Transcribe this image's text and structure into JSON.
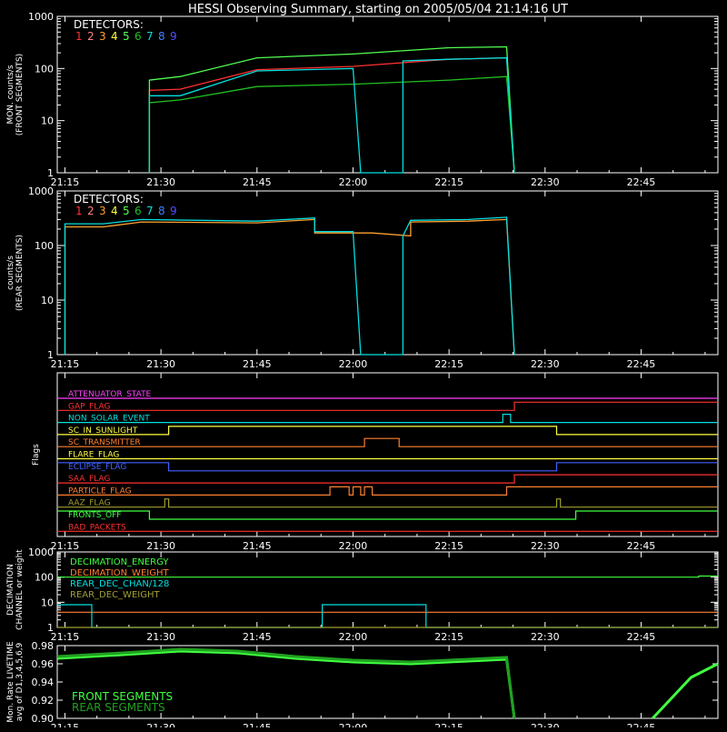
{
  "title": "HESSI Observing Summary, starting on 2005/05/04 21:14:16 UT",
  "time_ticks": [
    "21:15",
    "21:30",
    "21:45",
    "22:00",
    "22:15",
    "22:30",
    "22:45"
  ],
  "detector_colors": [
    "#ff3030",
    "#ff8080",
    "#ffa030",
    "#ffff40",
    "#50ff50",
    "#20c020",
    "#00e0e0",
    "#4080ff",
    "#5050ff"
  ],
  "chart_data": [
    {
      "type": "line",
      "panel": "front",
      "ylabel": "MON. counts/s (FRONT SEGMENTS)",
      "ylabel_lines": [
        "MON. counts/s",
        "(FRONT SEGMENTS)"
      ],
      "yscale": "log",
      "ylim": [
        1,
        1000
      ],
      "ytick_labels": [
        "1",
        "10",
        "100",
        "1000"
      ],
      "legend_title": "DETECTORS:",
      "legend_labels": [
        "1",
        "2",
        "3",
        "4",
        "5",
        "6",
        "7",
        "8",
        "9"
      ],
      "series": [
        {
          "name": "1",
          "color": "#ff3030",
          "values": [
            [
              21.47,
              1
            ],
            [
              21.47,
              38
            ],
            [
              21.55,
              40
            ],
            [
              21.75,
              95
            ],
            [
              22.0,
              110
            ],
            [
              22.25,
              150
            ],
            [
              22.4,
              160
            ],
            [
              22.42,
              1
            ]
          ]
        },
        {
          "name": "5",
          "color": "#50ff50",
          "values": [
            [
              21.47,
              1
            ],
            [
              21.47,
              60
            ],
            [
              21.55,
              70
            ],
            [
              21.75,
              160
            ],
            [
              22.0,
              190
            ],
            [
              22.25,
              250
            ],
            [
              22.4,
              260
            ],
            [
              22.42,
              1
            ]
          ]
        },
        {
          "name": "6",
          "color": "#20c020",
          "values": [
            [
              21.47,
              1
            ],
            [
              21.47,
              22
            ],
            [
              21.55,
              25
            ],
            [
              21.75,
              45
            ],
            [
              22.0,
              50
            ],
            [
              22.25,
              60
            ],
            [
              22.4,
              70
            ],
            [
              22.42,
              1
            ]
          ]
        },
        {
          "name": "7",
          "color": "#00e0e0",
          "values": [
            [
              21.47,
              1
            ],
            [
              21.47,
              30
            ],
            [
              21.55,
              30
            ],
            [
              21.75,
              90
            ],
            [
              22.0,
              100
            ],
            [
              22.02,
              1
            ],
            [
              22.13,
              1
            ],
            [
              22.13,
              140
            ],
            [
              22.25,
              150
            ],
            [
              22.4,
              160
            ],
            [
              22.42,
              1
            ]
          ]
        }
      ]
    },
    {
      "type": "line",
      "panel": "rear",
      "ylabel": "counts/s (REAR SEGMENTS)",
      "ylabel_lines": [
        "counts/s",
        "(REAR SEGMENTS)"
      ],
      "yscale": "log",
      "ylim": [
        1,
        1000
      ],
      "ytick_labels": [
        "1",
        "10",
        "100",
        "1000"
      ],
      "legend_title": "DETECTORS:",
      "legend_labels": [
        "1",
        "2",
        "3",
        "4",
        "5",
        "6",
        "7",
        "8",
        "9"
      ],
      "series": [
        {
          "name": "3",
          "color": "#ffa030",
          "values": [
            [
              21.25,
              1
            ],
            [
              21.25,
              220
            ],
            [
              21.35,
              220
            ],
            [
              21.45,
              270
            ],
            [
              21.75,
              260
            ],
            [
              21.9,
              300
            ],
            [
              21.9,
              170
            ],
            [
              22.05,
              170
            ],
            [
              22.15,
              150
            ],
            [
              22.15,
              270
            ],
            [
              22.3,
              280
            ],
            [
              22.4,
              300
            ],
            [
              22.42,
              1
            ]
          ]
        },
        {
          "name": "7",
          "color": "#00e0e0",
          "values": [
            [
              21.25,
              1
            ],
            [
              21.25,
              250
            ],
            [
              21.35,
              250
            ],
            [
              21.45,
              300
            ],
            [
              21.75,
              280
            ],
            [
              21.9,
              320
            ],
            [
              21.9,
              180
            ],
            [
              22.0,
              180
            ],
            [
              22.02,
              1
            ],
            [
              22.13,
              1
            ],
            [
              22.13,
              150
            ],
            [
              22.15,
              290
            ],
            [
              22.3,
              300
            ],
            [
              22.4,
              330
            ],
            [
              22.42,
              1
            ]
          ]
        }
      ]
    },
    {
      "type": "line",
      "panel": "flags",
      "ylabel": "Flags",
      "flags": [
        {
          "name": "ATTENUATOR_STATE",
          "color": "#ff40ff",
          "segments": [
            [
              21.23,
              22.95,
              0
            ]
          ]
        },
        {
          "name": "GAP_FLAG",
          "color": "#ff3030",
          "segments": [
            [
              21.23,
              22.42,
              0
            ],
            [
              22.42,
              22.95,
              1
            ]
          ]
        },
        {
          "name": "NON_SOLAR_EVENT",
          "color": "#00e0e0",
          "segments": [
            [
              21.23,
              22.39,
              0
            ],
            [
              22.39,
              22.41,
              1
            ],
            [
              22.41,
              22.95,
              0
            ]
          ]
        },
        {
          "name": "SC_IN_SUNLIGHT",
          "color": "#ffff40",
          "segments": [
            [
              21.23,
              21.52,
              0
            ],
            [
              21.52,
              22.53,
              1
            ],
            [
              22.53,
              22.95,
              0
            ]
          ]
        },
        {
          "name": "SC_TRANSMITTER",
          "color": "#ff8030",
          "segments": [
            [
              21.23,
              22.03,
              0
            ],
            [
              22.03,
              22.12,
              1
            ],
            [
              22.12,
              22.95,
              0
            ]
          ]
        },
        {
          "name": "FLARE_FLAG",
          "color": "#ffff40",
          "segments": [
            [
              21.23,
              22.95,
              0
            ]
          ]
        },
        {
          "name": "ECLIPSE_FLAG",
          "color": "#4060ff",
          "segments": [
            [
              21.23,
              21.52,
              1
            ],
            [
              21.52,
              22.53,
              0
            ],
            [
              22.53,
              22.95,
              1
            ]
          ]
        },
        {
          "name": "SAA_FLAG",
          "color": "#ff3030",
          "segments": [
            [
              21.23,
              22.42,
              0
            ],
            [
              22.42,
              22.95,
              1
            ]
          ]
        },
        {
          "name": "PARTICLE_FLAG",
          "color": "#ff8030",
          "segments": [
            [
              21.23,
              21.94,
              0
            ],
            [
              21.94,
              21.99,
              1
            ],
            [
              21.99,
              22.0,
              0
            ],
            [
              22.0,
              22.02,
              1
            ],
            [
              22.02,
              22.03,
              0
            ],
            [
              22.03,
              22.05,
              1
            ],
            [
              22.05,
              22.4,
              0
            ],
            [
              22.4,
              22.95,
              1
            ]
          ]
        },
        {
          "name": "AAZ_FLAG",
          "color": "#a0a030",
          "segments": [
            [
              21.23,
              21.51,
              0
            ],
            [
              21.51,
              21.52,
              1
            ],
            [
              21.52,
              22.53,
              0
            ],
            [
              22.53,
              22.54,
              1
            ],
            [
              22.54,
              22.95,
              0
            ]
          ]
        },
        {
          "name": "FRONTS_OFF",
          "color": "#40ff40",
          "segments": [
            [
              21.23,
              21.47,
              1
            ],
            [
              21.47,
              22.58,
              0
            ],
            [
              22.58,
              22.95,
              1
            ]
          ]
        },
        {
          "name": "BAD_PACKETS",
          "color": "#ff3030",
          "segments": [
            [
              21.23,
              22.95,
              0
            ]
          ]
        }
      ]
    },
    {
      "type": "line",
      "panel": "decimation",
      "ylabel": "DECIMATION CHANNEL or weight",
      "ylabel_lines": [
        "DECIMATION",
        "CHANNEL or weight"
      ],
      "yscale": "log",
      "ylim": [
        1,
        1000
      ],
      "ytick_labels": [
        "1",
        "10",
        "100",
        "1000"
      ],
      "series": [
        {
          "name": "DECIMATION_ENERGY",
          "color": "#40ff40",
          "values": [
            [
              21.23,
              100
            ],
            [
              22.9,
              100
            ],
            [
              22.9,
              110
            ],
            [
              22.95,
              110
            ]
          ]
        },
        {
          "name": "DECIMATION_WEIGHT",
          "color": "#ff8030",
          "values": [
            [
              21.23,
              4
            ],
            [
              22.95,
              4
            ]
          ]
        },
        {
          "name": "REAR_DEC_CHAN/128",
          "color": "#00e0e0",
          "values": [
            [
              21.23,
              8
            ],
            [
              21.32,
              8
            ],
            [
              21.32,
              1
            ],
            [
              21.92,
              1
            ],
            [
              21.92,
              8
            ],
            [
              22.19,
              8
            ],
            [
              22.19,
              1
            ],
            [
              22.95,
              1
            ]
          ]
        },
        {
          "name": "REAR_DEC_WEIGHT",
          "color": "#a0a030",
          "values": [
            [
              21.23,
              1
            ],
            [
              22.95,
              1
            ]
          ]
        }
      ]
    },
    {
      "type": "line",
      "panel": "livetime",
      "ylabel": "Mon. Rate LIVETIME avg of D1,3,4,5,6,9",
      "ylabel_lines": [
        "Mon. Rate LIVETIME",
        "avg of D1,3,4,5,6,9"
      ],
      "ylim": [
        0.9,
        0.98
      ],
      "ytick_labels": [
        "0.90",
        "0.92",
        "0.94",
        "0.96",
        "0.98"
      ],
      "series": [
        {
          "name": "FRONT SEGMENTS",
          "color": "#40ff40",
          "values": [
            [
              21.23,
              0.966
            ],
            [
              21.4,
              0.97
            ],
            [
              21.55,
              0.974
            ],
            [
              21.7,
              0.972
            ],
            [
              21.85,
              0.966
            ],
            [
              22.0,
              0.962
            ],
            [
              22.15,
              0.96
            ],
            [
              22.3,
              0.963
            ],
            [
              22.4,
              0.965
            ],
            [
              22.42,
              0.9
            ]
          ]
        },
        {
          "name": "REAR SEGMENTS",
          "color": "#20a020",
          "values": [
            [
              21.23,
              0.968
            ],
            [
              21.4,
              0.972
            ],
            [
              21.55,
              0.976
            ],
            [
              21.7,
              0.974
            ],
            [
              21.85,
              0.968
            ],
            [
              22.0,
              0.964
            ],
            [
              22.15,
              0.962
            ],
            [
              22.3,
              0.965
            ],
            [
              22.4,
              0.967
            ],
            [
              22.42,
              0.9
            ]
          ]
        },
        {
          "name": "FRONT SEGMENTS tail",
          "color": "#40ff40",
          "values": [
            [
              22.78,
              0.9
            ],
            [
              22.88,
              0.945
            ],
            [
              22.95,
              0.96
            ]
          ]
        }
      ]
    }
  ]
}
